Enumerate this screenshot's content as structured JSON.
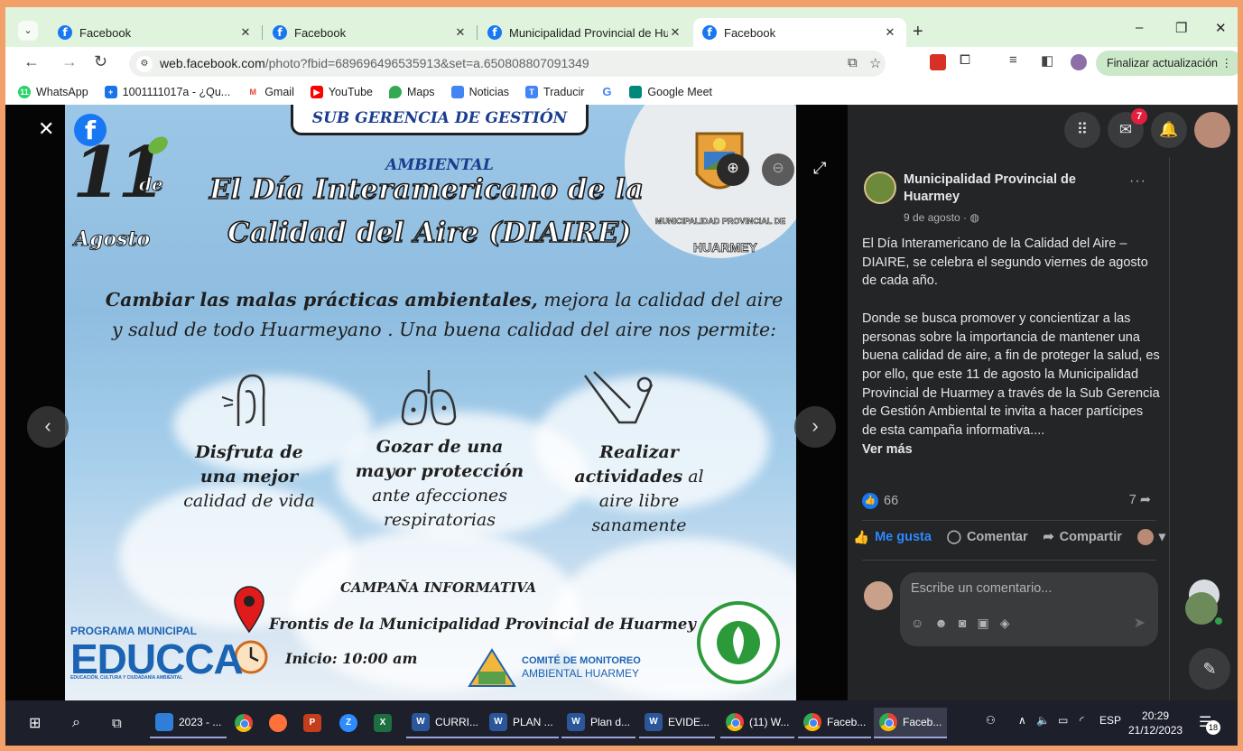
{
  "browser": {
    "tabs": [
      {
        "label": "Facebook",
        "active": false
      },
      {
        "label": "Facebook",
        "active": false
      },
      {
        "label": "Municipalidad Provincial de Hu",
        "active": false
      },
      {
        "label": "Facebook",
        "active": true
      }
    ],
    "new_tab": "+",
    "window_controls": {
      "minimize": "–",
      "restore": "❐",
      "close": "✕"
    },
    "url_host": "web.facebook.com",
    "url_path": "/photo?fbid=689696496535913&set=a.650808807091349",
    "update_button": "Finalizar actualización",
    "bookmarks": [
      {
        "label": "WhatsApp",
        "icon": "whatsapp-icon",
        "color": "#25d366"
      },
      {
        "label": "1001111017a - ¿Qu...",
        "icon": "bookmark-doc-icon",
        "color": "#1a73e8"
      },
      {
        "label": "Gmail",
        "icon": "gmail-icon",
        "color": "#ea4335"
      },
      {
        "label": "YouTube",
        "icon": "youtube-icon",
        "color": "#ff0000"
      },
      {
        "label": "Maps",
        "icon": "maps-icon",
        "color": "#34a853"
      },
      {
        "label": "Noticias",
        "icon": "news-icon",
        "color": "#4285f4"
      },
      {
        "label": "Traducir",
        "icon": "translate-icon",
        "color": "#4285f4"
      },
      {
        "label": "",
        "icon": "google-icon",
        "color": "#4285f4"
      },
      {
        "label": "Google Meet",
        "icon": "meet-icon",
        "color": "#00897b"
      }
    ]
  },
  "poster": {
    "banner": "SUB GERENCIA DE GESTIÓN AMBIENTAL",
    "date_day": "11",
    "date_de": "de",
    "date_month": "Agosto",
    "title_line1": "El Día Interamericano de la",
    "title_line2": "Calidad del Aire (DIAIRE)",
    "muni_small": "MUNICIPALIDAD PROVINCIAL DE",
    "muni_big": "HUARMEY",
    "intro_bold": "Cambiar las malas prácticas ambientales,",
    "intro_rest": " mejora la calidad del aire y salud de todo Huarmeyano . Una buena calidad  del aire  nos permite:",
    "items": [
      {
        "bold": "Disfruta de una mejor",
        "rest": "calidad de vida"
      },
      {
        "bold": "Gozar de una mayor protección",
        "rest": " ante afecciones respiratorias"
      },
      {
        "bold": "Realizar actividades",
        "rest": " al aire libre sanamente"
      }
    ],
    "campaign": "CAMPAÑA INFORMATIVA",
    "location": "Frontis de la Municipalidad Provincial de Huarmey",
    "start": "Inicio: 10:00 am",
    "educca_top": "PROGRAMA MUNICIPAL",
    "educca": "EDUCCA",
    "educca_sub": "EDUCACIÓN, CULTURA Y CIUDADANÍA AMBIENTAL",
    "comite_line1": "COMITÉ DE MONITOREO",
    "comite_line2": "AMBIENTAL HUARMEY"
  },
  "viewer": {
    "close": "✕",
    "prev": "‹",
    "next": "›",
    "zoom_in": "⊕",
    "zoom_out": "⊖",
    "fullscreen": "⤢"
  },
  "panel": {
    "messenger_badge": "7",
    "author": "Municipalidad Provincial de Huarmey",
    "date": "9 de agosto · ",
    "more": "···",
    "body_p1": "El Día Interamericano de la Calidad del Aire – DIAIRE, se celebra el segundo viernes de agosto de cada año.",
    "body_p2": "Donde se busca promover y concientizar a las personas sobre la importancia de mantener una buena calidad de aire, a fin de proteger la salud, es por ello, que este 11 de agosto la Municipalidad Provincial de Huarmey a través de la Sub Gerencia de Gestión Ambiental te invita a hacer partícipes de esta campaña informativa....",
    "see_more": "Ver más",
    "likes": "66",
    "shares": "7",
    "action_like": "Me gusta",
    "action_comment": "Comentar",
    "action_share": "Compartir",
    "comment_placeholder": "Escribe un comentario..."
  },
  "taskbar": {
    "items": [
      {
        "label": "2023 - ...",
        "icon": "files-icon",
        "color": "#2f7ed8"
      },
      {
        "label": "",
        "icon": "chrome-icon",
        "color": "#4285f4"
      },
      {
        "label": "",
        "icon": "firefox-icon",
        "color": "#ff7139"
      },
      {
        "label": "",
        "icon": "powerpoint-icon",
        "color": "#c43e1c"
      },
      {
        "label": "",
        "icon": "zoom-icon",
        "color": "#2d8cff"
      },
      {
        "label": "",
        "icon": "excel-icon",
        "color": "#1d6f42"
      },
      {
        "label": "CURRI...",
        "icon": "word-icon",
        "color": "#2b579a"
      },
      {
        "label": "PLAN ...",
        "icon": "word-icon",
        "color": "#2b579a"
      },
      {
        "label": "Plan d...",
        "icon": "word-icon",
        "color": "#2b579a"
      },
      {
        "label": "EVIDE...",
        "icon": "word-icon",
        "color": "#2b579a"
      },
      {
        "label": "(11) W...",
        "icon": "chrome-icon",
        "color": "#4285f4"
      },
      {
        "label": "Faceb...",
        "icon": "chrome-icon",
        "color": "#4285f4"
      },
      {
        "label": "Faceb...",
        "icon": "chrome-icon",
        "color": "#4285f4"
      }
    ],
    "lang": "ESP",
    "time": "20:29",
    "date": "21/12/2023",
    "notifications": "18"
  }
}
